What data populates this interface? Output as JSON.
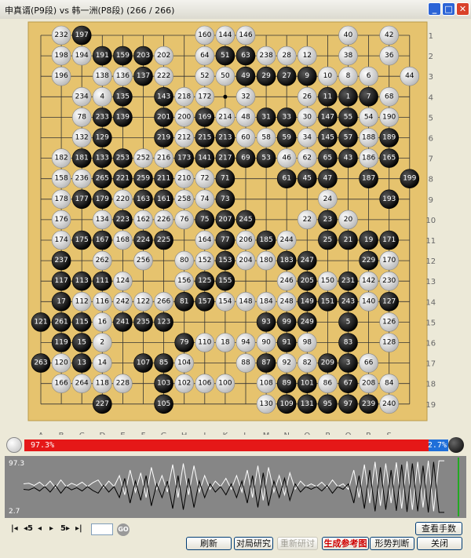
{
  "window": {
    "title": "申真谞(P9段) vs 韩一洲(P8段) (266 / 266)",
    "min_label": "_",
    "max_label": "□",
    "close_label": "✕"
  },
  "board": {
    "size": 19,
    "column_labels": [
      "A",
      "B",
      "C",
      "D",
      "E",
      "F",
      "G",
      "H",
      "J",
      "K",
      "L",
      "M",
      "N",
      "O",
      "P",
      "Q",
      "R",
      "S"
    ],
    "row_labels": [
      "1",
      "2",
      "3",
      "4",
      "5",
      "6",
      "7",
      "8",
      "9",
      "10",
      "11",
      "12",
      "13",
      "14",
      "15",
      "16",
      "17",
      "18",
      "19"
    ],
    "rows": [
      [
        "",
        "232w",
        "197b",
        "",
        "",
        "",
        "",
        "",
        "160w",
        "144w",
        "146w",
        "",
        "",
        "",
        "",
        "40w",
        "",
        "42w"
      ],
      [
        "",
        "198w",
        "194w",
        "191b",
        "159b",
        "203b",
        "202w",
        "",
        "64w",
        "51b",
        "63b",
        "238w",
        "28w",
        "12w",
        "",
        "38w",
        "",
        "36w"
      ],
      [
        "",
        "196w",
        "",
        "138w",
        "136w",
        "137b",
        "222w",
        "",
        "52w",
        "50w",
        "49b",
        "29b",
        "27b",
        "9b",
        "10w",
        "8w",
        "6w",
        "",
        "44w"
      ],
      [
        "",
        "",
        "234w",
        "4w",
        "135b",
        "",
        "143b",
        "218w",
        "172w",
        "",
        "32w",
        "",
        "",
        "26w",
        "11b",
        "1b",
        "7b",
        "68w"
      ],
      [
        "",
        "",
        "78w",
        "233b",
        "139b",
        "",
        "201b",
        "200w",
        "169b",
        "214w",
        "48w",
        "31b",
        "33b",
        "30w",
        "147b",
        "55b",
        "54w",
        "190w"
      ],
      [
        "",
        "",
        "132w",
        "129b",
        "",
        "",
        "219b",
        "212w",
        "215b",
        "213b",
        "60w",
        "58w",
        "59b",
        "34w",
        "145b",
        "57b",
        "188w",
        "189b"
      ],
      [
        "",
        "182w",
        "181b",
        "133b",
        "253b",
        "252w",
        "216w",
        "173b",
        "141b",
        "217b",
        "69b",
        "53b",
        "46w",
        "62w",
        "65b",
        "43b",
        "186w",
        "165b"
      ],
      [
        "",
        "158w",
        "236w",
        "265b",
        "221b",
        "259b",
        "211b",
        "210w",
        "72w",
        "71b",
        "",
        "",
        "61b",
        "45b",
        "47b",
        "",
        "187b",
        "",
        "199b"
      ],
      [
        "",
        "178w",
        "177b",
        "179b",
        "220w",
        "163b",
        "161b",
        "258w",
        "74w",
        "73b",
        "",
        "",
        "",
        "",
        "24w",
        "",
        "",
        "193b"
      ],
      [
        "",
        "176w",
        "",
        "134w",
        "223b",
        "162w",
        "226w",
        "76w",
        "75b",
        "207b",
        "245b",
        "",
        "",
        "22w",
        "23b",
        "20w"
      ],
      [
        "",
        "174w",
        "175b",
        "167b",
        "168w",
        "224b",
        "225b",
        "",
        "164w",
        "77b",
        "206w",
        "185b",
        "244w",
        "",
        "25b",
        "21b",
        "19b",
        "171b"
      ],
      [
        "",
        "237b",
        "",
        "262w",
        "",
        "256w",
        "",
        "80w",
        "152w",
        "153b",
        "204w",
        "180w",
        "183b",
        "247b",
        "",
        "",
        "229b",
        "170w"
      ],
      [
        "",
        "117b",
        "113b",
        "111b",
        "124w",
        "",
        "",
        "156w",
        "125b",
        "155b",
        "",
        "",
        "246w",
        "205b",
        "150w",
        "231b",
        "142w",
        "230w"
      ],
      [
        "",
        "17b",
        "112w",
        "116w",
        "242w",
        "122w",
        "266w",
        "81b",
        "157b",
        "154w",
        "148w",
        "184w",
        "248w",
        "149b",
        "151b",
        "243b",
        "140w",
        "127b"
      ],
      [
        "121b",
        "261b",
        "115b",
        "16w",
        "241b",
        "235b",
        "123b",
        "",
        "",
        "",
        "",
        "93b",
        "99b",
        "249b",
        "",
        "5b",
        "",
        "126w"
      ],
      [
        "",
        "119b",
        "15b",
        "2w",
        "",
        "",
        "",
        "79b",
        "110w",
        "18w",
        "94w",
        "90w",
        "91b",
        "98w",
        "",
        "83b",
        "",
        "128w"
      ],
      [
        "263b",
        "120w",
        "13b",
        "14w",
        "",
        "107b",
        "85b",
        "104w",
        "",
        "",
        "88w",
        "87b",
        "92w",
        "82w",
        "209b",
        "3b",
        "66w"
      ],
      [
        "",
        "166w",
        "264w",
        "118w",
        "228w",
        "",
        "103b",
        "102w",
        "106w",
        "100w",
        "",
        "108w",
        "89b",
        "101b",
        "86w",
        "67b",
        "208w",
        "84w"
      ],
      [
        "",
        "",
        "",
        "227b",
        "",
        "",
        "105b",
        "",
        "",
        "",
        "",
        "130w",
        "109b",
        "131b",
        "95b",
        "97b",
        "239b",
        "240w"
      ]
    ]
  },
  "win_rate": {
    "white_pct": "97.3%",
    "black_pct": "2.7%",
    "white_fraction": 0.973
  },
  "graph": {
    "label_top": "97.3",
    "label_bottom": "2.7",
    "white_series": [
      55,
      56,
      52,
      58,
      50,
      60,
      48,
      62,
      50,
      56,
      52,
      58,
      50,
      57,
      62,
      48,
      60,
      50,
      70,
      35,
      80,
      40,
      75,
      30,
      85,
      45,
      70,
      40,
      90,
      30,
      92,
      35,
      88,
      40,
      70,
      45,
      60,
      50,
      65,
      45,
      70,
      40,
      80,
      30,
      88,
      25,
      85,
      40,
      70,
      35,
      75,
      45,
      60,
      50,
      55,
      50,
      58,
      48,
      62,
      50,
      55,
      45,
      80,
      30,
      90,
      20,
      95,
      15,
      92,
      20,
      94,
      10,
      96,
      8,
      95,
      12,
      97,
      5,
      97,
      97
    ],
    "black_series": [
      45,
      44,
      48,
      42,
      50,
      40,
      52,
      38,
      50,
      44,
      48,
      42,
      50,
      43,
      38,
      52,
      40,
      50,
      30,
      65,
      20,
      60,
      25,
      70,
      15,
      55,
      30,
      60,
      10,
      70,
      8,
      65,
      12,
      60,
      30,
      55,
      40,
      50,
      35,
      55,
      30,
      60,
      20,
      70,
      12,
      75,
      15,
      60,
      30,
      65,
      25,
      55,
      40,
      50,
      45,
      50,
      42,
      52,
      38,
      50,
      45,
      55,
      20,
      70,
      10,
      80,
      5,
      85,
      8,
      80,
      6,
      90,
      4,
      92,
      5,
      88,
      3,
      95,
      3,
      3
    ]
  },
  "controls": {
    "nav_first": "|◂",
    "nav_back5": "◂5",
    "nav_prev": "◂",
    "nav_next": "▸",
    "nav_fwd5": "5▸",
    "nav_last": "▸|",
    "go_label": "GO",
    "view_moves": "查看手数",
    "refresh": "刷新",
    "game_study": "对局研究",
    "restart_study": "重新研讨",
    "generate_ref": "生成参考图",
    "judge_position": "形势判断",
    "close": "关闭"
  },
  "colors": {
    "board": "#e6c36e",
    "red": "#e51818",
    "blue": "#1f6fd9"
  }
}
